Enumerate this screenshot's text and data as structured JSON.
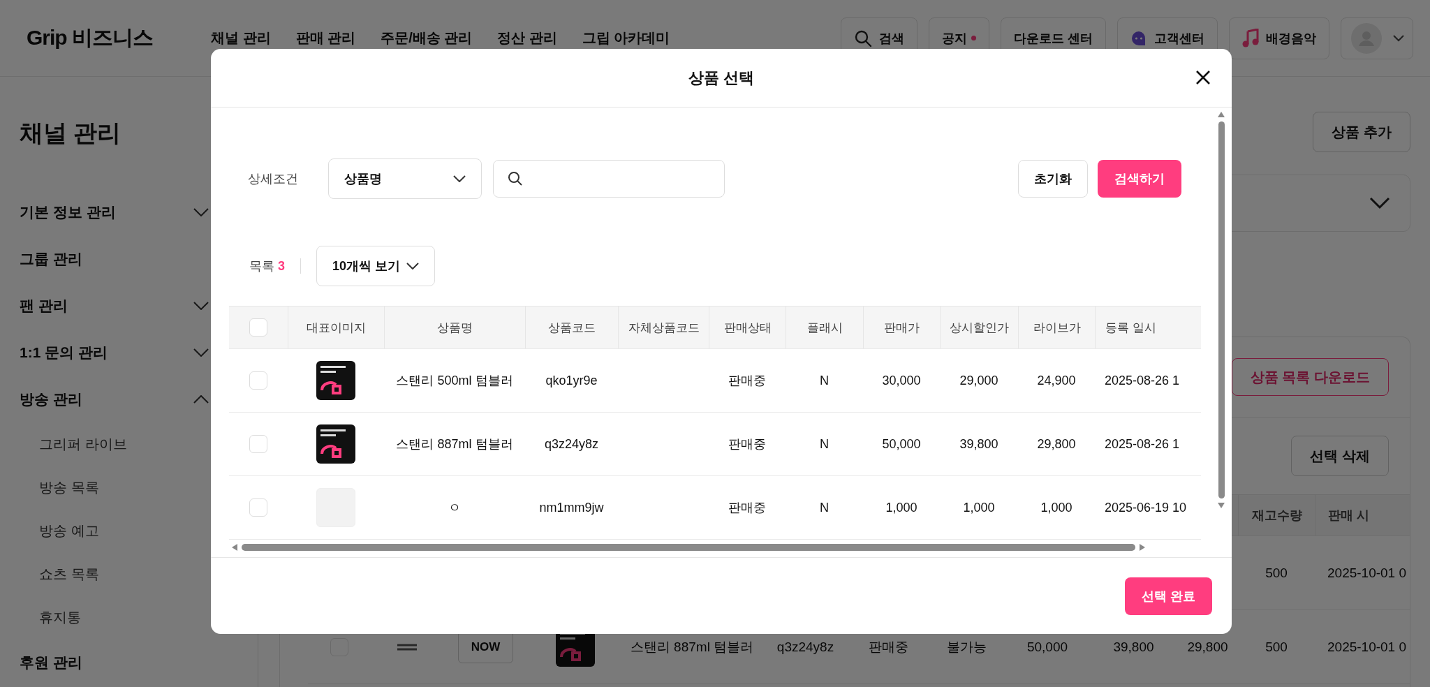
{
  "header": {
    "logo": "Grip 비즈니스",
    "nav": [
      {
        "label": "채널 관리"
      },
      {
        "label": "판매 관리"
      },
      {
        "label": "주문/배송 관리"
      },
      {
        "label": "정산 관리"
      },
      {
        "label": "그립 아카데미"
      }
    ],
    "tools": [
      {
        "kind": "search",
        "label": "검색"
      },
      {
        "kind": "notice",
        "label": "공지",
        "unread": true
      },
      {
        "kind": "plain",
        "label": "다운로드 센터"
      },
      {
        "kind": "support",
        "label": "고객센터"
      },
      {
        "kind": "music",
        "label": "배경음악"
      },
      {
        "kind": "account"
      }
    ]
  },
  "sidebar": {
    "title": "채널 관리",
    "items": [
      {
        "label": "기본 정보 관리",
        "kind": "folder",
        "expanded": false
      },
      {
        "label": "그룹 관리",
        "kind": "link"
      },
      {
        "label": "팬 관리",
        "kind": "folder",
        "expanded": false
      },
      {
        "label": "1:1 문의 관리",
        "kind": "folder",
        "expanded": false
      },
      {
        "label": "방송 관리",
        "kind": "folder",
        "expanded": true,
        "children": [
          {
            "label": "그리퍼 라이브"
          },
          {
            "label": "방송 목록"
          },
          {
            "label": "방송 예고"
          },
          {
            "label": "쇼츠 목록"
          },
          {
            "label": "휴지통"
          }
        ]
      },
      {
        "label": "후원 관리",
        "kind": "link"
      }
    ]
  },
  "main": {
    "add_button": "상품 추가",
    "filter_card": {
      "expanded": false
    },
    "product_card": {
      "download_button": "상품 목록 다운로드",
      "delete_button": "선택 삭제",
      "columns": [
        {
          "label": "재고수량"
        },
        {
          "label": "판매 시"
        }
      ],
      "rows": [
        {
          "stock": "500",
          "sale_start": "2025-10-01 0"
        },
        {
          "checked": false,
          "badge": "NOW",
          "name": "스탠리 887ml 텀블러",
          "code": "q3z24y8z",
          "status": "판매중",
          "flash": "불가능",
          "price": "50,000",
          "discount_price": "39,800",
          "live_price": "29,800",
          "stock": "500",
          "sale_start": "2025-10-01 0"
        }
      ]
    }
  },
  "modal": {
    "title": "상품 선택",
    "filter": {
      "label": "상세조건",
      "field": "상품명",
      "reset": "초기화",
      "search": "검색하기"
    },
    "list": {
      "label": "목록",
      "count": "3",
      "page_size": "10개씩 보기"
    },
    "table": {
      "all_checked": false,
      "columns": [
        {
          "label": "대표이미지"
        },
        {
          "label": "상품명"
        },
        {
          "label": "상품코드"
        },
        {
          "label": "자체상품코드"
        },
        {
          "label": "판매상태"
        },
        {
          "label": "플래시"
        },
        {
          "label": "판매가"
        },
        {
          "label": "상시할인가"
        },
        {
          "label": "라이브가"
        },
        {
          "label": "등록 일시"
        }
      ],
      "rows": [
        {
          "checked": false,
          "name": "스탠리 500ml 텀블러",
          "code": "qko1yr9e",
          "status": "판매중",
          "flash": "N",
          "price": "30,000",
          "discount_price": "29,000",
          "live_price": "24,900",
          "registered_at": "2025-08-26 1"
        },
        {
          "checked": false,
          "name": "스탠리 887ml 텀블러",
          "code": "q3z24y8z",
          "status": "판매중",
          "flash": "N",
          "price": "50,000",
          "discount_price": "39,800",
          "live_price": "29,800",
          "registered_at": "2025-08-26 1"
        },
        {
          "checked": false,
          "thumbnail": {
            "kind": "empty"
          },
          "name": "ㅇ",
          "code": "nm1mm9jw",
          "status": "판매중",
          "flash": "N",
          "price": "1,000",
          "discount_price": "1,000",
          "live_price": "1,000",
          "registered_at": "2025-06-19 10"
        }
      ]
    },
    "confirm": "선택 완료"
  }
}
